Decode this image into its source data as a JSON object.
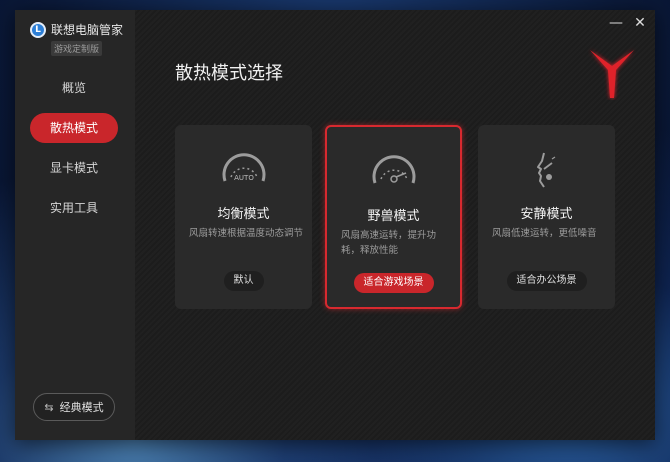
{
  "app": {
    "name": "联想电脑管家",
    "logo_letter": "L",
    "edition": "游戏定制版"
  },
  "sidebar": {
    "items": [
      {
        "label": "概览",
        "active": false
      },
      {
        "label": "散热模式",
        "active": true
      },
      {
        "label": "显卡模式",
        "active": false
      },
      {
        "label": "实用工具",
        "active": false
      }
    ],
    "classic_button": {
      "label": "经典模式",
      "icon": "swap-arrows-icon"
    }
  },
  "window_controls": {
    "minimize": "—",
    "close": "✕"
  },
  "main": {
    "title": "散热模式选择",
    "modes": [
      {
        "name": "均衡模式",
        "desc": "风扇转速根据温度动态调节",
        "pill": "默认",
        "icon": "gauge-auto-icon",
        "gauge_text": "AUTO",
        "selected": false
      },
      {
        "name": "野兽模式",
        "desc": "风扇高速运转，提升功耗，释放性能",
        "pill": "适合游戏场景",
        "icon": "gauge-max-icon",
        "selected": true
      },
      {
        "name": "安静模式",
        "desc": "风扇低速运转，更低噪音",
        "pill": "适合办公场景",
        "icon": "quiet-face-icon",
        "selected": false
      }
    ]
  },
  "colors": {
    "accent": "#c9262b",
    "background": "#1d1d1d",
    "sidebar": "#262626"
  }
}
